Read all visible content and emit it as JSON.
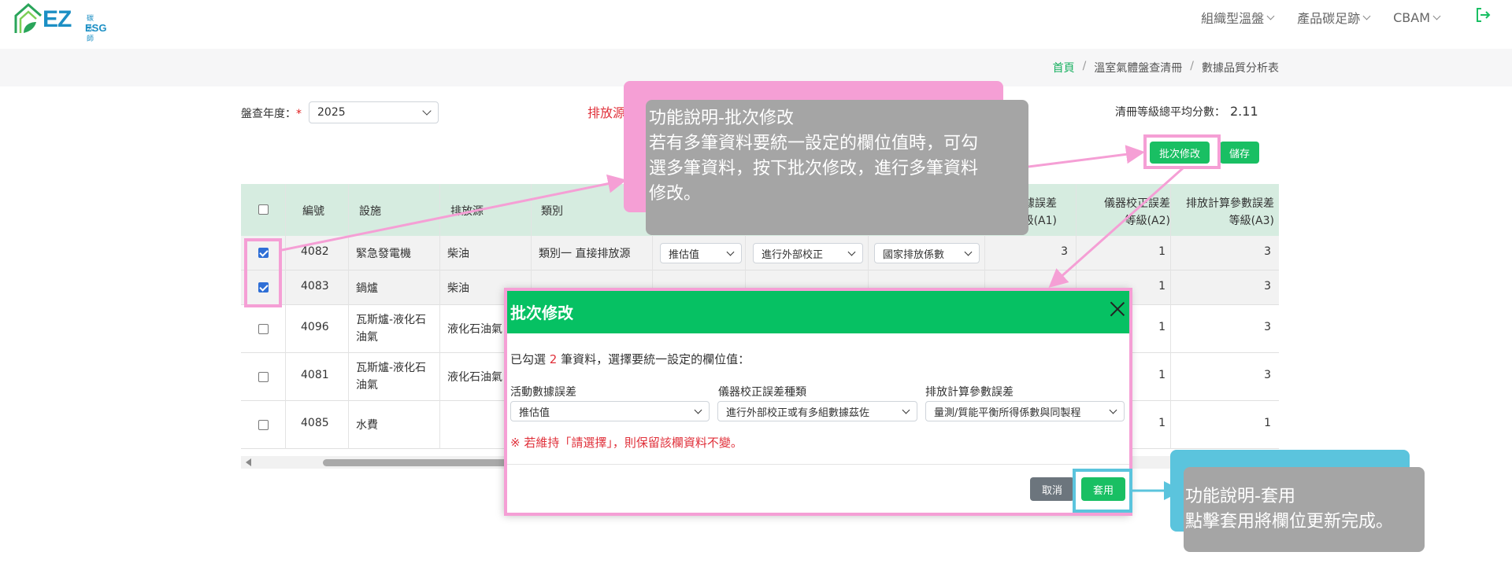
{
  "header": {
    "logo_text": "EZ",
    "logo_sub": "ESG",
    "logo_cn": "碳大師",
    "nav": [
      {
        "label": "組織型溫盤"
      },
      {
        "label": "產品碳足跡"
      },
      {
        "label": "CBAM"
      }
    ],
    "logout_icon": "logout-icon"
  },
  "breadcrumb": {
    "home": "首頁",
    "sep": "/",
    "level1": "溫室氣體盤查清冊",
    "current": "數據品質分析表"
  },
  "toolbar": {
    "year_label": "盤查年度：",
    "year_required": "*",
    "year_value": "2025",
    "emission_label": "排放源",
    "avg_label": "清冊等級總平均分數：",
    "avg_value": "2.11",
    "batch_button": "批次修改",
    "save_button": "儲存"
  },
  "table": {
    "headers": {
      "id": "編號",
      "facility": "設施",
      "source": "排放源",
      "category": "類別",
      "a1": "數據誤差等級(A1)",
      "a1_visible": [
        "數據誤差",
        "等級(A1)"
      ],
      "a2": [
        "儀器校正誤差",
        "等級(A2)"
      ],
      "a3": [
        "排放計算參數誤差",
        "等級(A3)"
      ]
    },
    "rows": [
      {
        "checked": true,
        "id": "4082",
        "facility": "緊急發電機",
        "source": "柴油",
        "category": "類別一 直接排放源",
        "activity": "推估值",
        "calibration": "進行外部校正",
        "factor": "國家排放係數",
        "a1": "3",
        "a2": "1",
        "a3": "3"
      },
      {
        "checked": true,
        "id": "4083",
        "facility": "鍋爐",
        "source": "柴油",
        "category": "",
        "activity": "",
        "calibration": "",
        "factor": "",
        "a1": "",
        "a2": "1",
        "a3": "3"
      },
      {
        "checked": false,
        "id": "4096",
        "facility": "瓦斯爐-液化石油氣",
        "source": "液化石油氣",
        "category": "",
        "activity": "",
        "calibration": "",
        "factor": "",
        "a1": "",
        "a2": "1",
        "a3": "3"
      },
      {
        "checked": false,
        "id": "4081",
        "facility": "瓦斯爐-液化石油氣",
        "source": "液化石油氣",
        "category": "",
        "activity": "",
        "calibration": "",
        "factor": "",
        "a1": "",
        "a2": "1",
        "a3": "3"
      },
      {
        "checked": false,
        "id": "4085",
        "facility": "水費",
        "source": "",
        "category": "",
        "activity": "",
        "calibration": "",
        "factor": "",
        "a1": "",
        "a2": "1",
        "a3": "1"
      }
    ],
    "facility_lines": {
      "4096": [
        "瓦斯爐-液化石",
        "油氣"
      ],
      "4081": [
        "瓦斯爐-液化石",
        "油氣"
      ]
    },
    "source_truncated": "液化石油氣"
  },
  "modal": {
    "title": "批次修改",
    "info_prefix": "已勾選",
    "info_count": "2",
    "info_suffix": "筆資料，選擇要統一設定的欄位值：",
    "fields": [
      {
        "label": "活動數據誤差",
        "value": "推估值"
      },
      {
        "label": "儀器校正誤差種類",
        "value": "進行外部校正或有多組數據茲佐"
      },
      {
        "label": "排放計算參數誤差",
        "value": "量測/質能平衡所得係數與同製程"
      }
    ],
    "warning": "※ 若維持「請選擇」，則保留該欄資料不變。",
    "cancel": "取消",
    "apply": "套用"
  },
  "annotations": {
    "tip1_lines": [
      "功能說明-批次修改",
      "若有多筆資料要統一設定的欄位值時，可勾",
      "選多筆資料，按下批次修改，進行多筆資料",
      "修改。"
    ],
    "tip2_lines": [
      "功能說明-套用",
      "點擊套用將欄位更新完成。"
    ],
    "pink": "#f59fd5",
    "cyan": "#5bc4dd"
  },
  "colors": {
    "brand_green": "#19bf63",
    "header_green": "#06c163",
    "table_header": "#d6ece0",
    "danger": "#e0303a"
  }
}
